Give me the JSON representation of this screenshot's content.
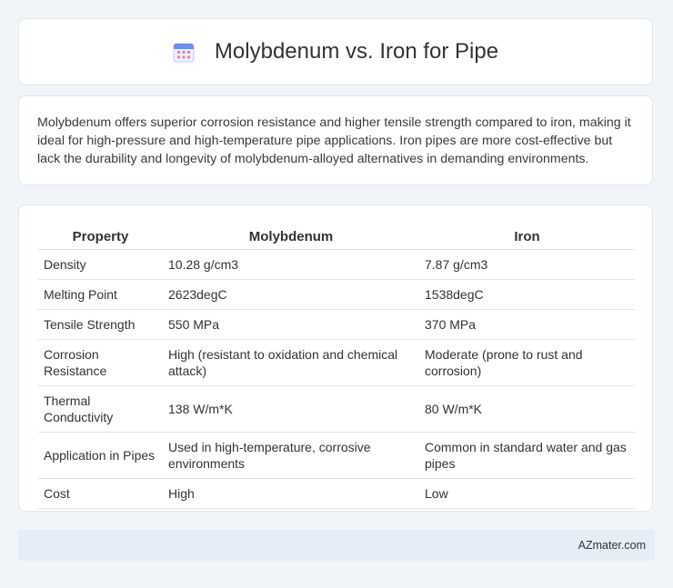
{
  "header": {
    "title": "Molybdenum vs. Iron for Pipe",
    "icon": "calendar-icon"
  },
  "intro": {
    "text": "Molybdenum offers superior corrosion resistance and higher tensile strength compared to iron, making it ideal for high-pressure and high-temperature pipe applications. Iron pipes are more cost-effective but lack the durability and longevity of molybdenum-alloyed alternatives in demanding environments."
  },
  "table": {
    "headers": [
      "Property",
      "Molybdenum",
      "Iron"
    ],
    "rows": [
      [
        "Density",
        "10.28 g/cm3",
        "7.87 g/cm3"
      ],
      [
        "Melting Point",
        "2623degC",
        "1538degC"
      ],
      [
        "Tensile Strength",
        "550 MPa",
        "370 MPa"
      ],
      [
        "Corrosion Resistance",
        "High (resistant to oxidation and chemical attack)",
        "Moderate (prone to rust and corrosion)"
      ],
      [
        "Thermal Conductivity",
        "138 W/m*K",
        "80 W/m*K"
      ],
      [
        "Application in Pipes",
        "Used in high-temperature, corrosive environments",
        "Common in standard water and gas pipes"
      ],
      [
        "Cost",
        "High",
        "Low"
      ]
    ]
  },
  "footer": {
    "brand": "AZmater.com"
  }
}
